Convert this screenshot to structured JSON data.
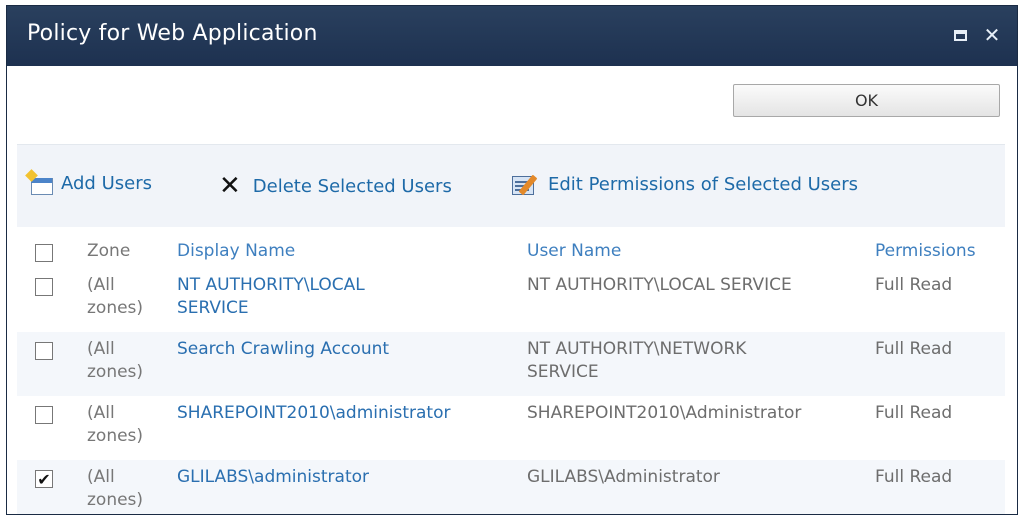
{
  "dialog": {
    "title": "Policy for Web Application",
    "icons": {
      "maximize": "maximize-icon",
      "close": "close-icon"
    },
    "ok_label": "OK"
  },
  "toolbar": {
    "add_users": "Add Users",
    "delete_selected": "Delete Selected Users",
    "edit_permissions": "Edit Permissions of Selected Users"
  },
  "table": {
    "headers": {
      "zone": "Zone",
      "display_name": "Display Name",
      "user_name": "User Name",
      "permissions": "Permissions"
    },
    "rows": [
      {
        "checked": false,
        "zone_line1": "(All",
        "zone_line2": "zones)",
        "display_line1": "NT AUTHORITY\\LOCAL",
        "display_line2": "SERVICE",
        "user_line1": "NT AUTHORITY\\LOCAL SERVICE",
        "user_line2": "",
        "permissions": "Full Read"
      },
      {
        "checked": false,
        "zone_line1": "(All",
        "zone_line2": "zones)",
        "display_line1": "Search Crawling Account",
        "display_line2": "",
        "user_line1": "NT AUTHORITY\\NETWORK",
        "user_line2": "SERVICE",
        "permissions": "Full Read"
      },
      {
        "checked": false,
        "zone_line1": "(All",
        "zone_line2": "zones)",
        "display_line1": "SHAREPOINT2010\\administrator",
        "display_line2": "",
        "user_line1": "SHAREPOINT2010\\Administrator",
        "user_line2": "",
        "permissions": "Full Read"
      },
      {
        "checked": true,
        "zone_line1": "(All",
        "zone_line2": "zones)",
        "display_line1": "GLILABS\\administrator",
        "display_line2": "",
        "user_line1": "GLILABS\\Administrator",
        "user_line2": "",
        "permissions": "Full Read"
      }
    ]
  },
  "colors": {
    "title_bar": "#1d3150",
    "link": "#2a6fb0",
    "toolbar_bg": "#f1f4f9"
  }
}
